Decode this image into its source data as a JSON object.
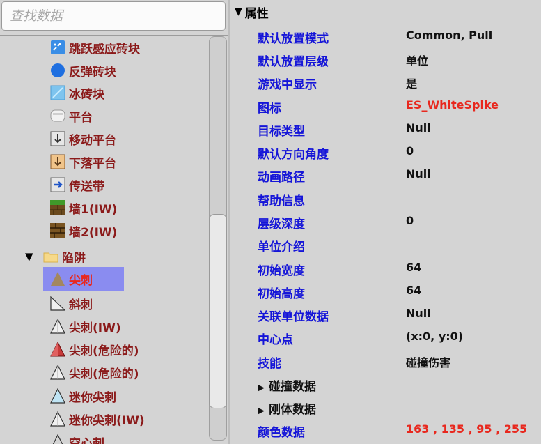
{
  "search": {
    "placeholder": "查找数据"
  },
  "tree": {
    "items": [
      {
        "label": "跳跃感应砖块",
        "icon": "jump-sensor-block-icon"
      },
      {
        "label": "反弹砖块",
        "icon": "bounce-block-icon"
      },
      {
        "label": "冰砖块",
        "icon": "ice-block-icon"
      },
      {
        "label": "平台",
        "icon": "platform-icon"
      },
      {
        "label": "移动平台",
        "icon": "moving-platform-icon"
      },
      {
        "label": "下落平台",
        "icon": "falling-platform-icon"
      },
      {
        "label": "传送带",
        "icon": "conveyor-icon"
      },
      {
        "label": "墙1(IW)",
        "icon": "wall1-icon"
      },
      {
        "label": "墙2(IW)",
        "icon": "wall2-icon"
      },
      {
        "label": "陷阱",
        "icon": "folder-icon"
      },
      {
        "label": "尖刺",
        "icon": "spike-brown-icon"
      },
      {
        "label": "斜刺",
        "icon": "slope-spike-icon"
      },
      {
        "label": "尖刺(IW)",
        "icon": "spike-white-icon"
      },
      {
        "label": "尖刺(危险的)",
        "icon": "spike-red-icon"
      },
      {
        "label": "尖刺(危险的)",
        "icon": "spike-white-icon"
      },
      {
        "label": "迷你尖刺",
        "icon": "mini-spike-blue-icon"
      },
      {
        "label": "迷你尖刺(IW)",
        "icon": "mini-spike-white-icon"
      },
      {
        "label": "空心刺",
        "icon": "hollow-spike-icon"
      }
    ]
  },
  "properties": {
    "header": "属性",
    "rows": [
      {
        "key": "默认放置模式",
        "value": "Common, Pull"
      },
      {
        "key": "默认放置层级",
        "value": "单位"
      },
      {
        "key": "游戏中显示",
        "value": "是"
      },
      {
        "key": "图标",
        "value": "ES_WhiteSpike"
      },
      {
        "key": "目标类型",
        "value": "Null"
      },
      {
        "key": "默认方向角度",
        "value": "0"
      },
      {
        "key": "动画路径",
        "value": "Null"
      },
      {
        "key": "帮助信息",
        "value": ""
      },
      {
        "key": "层级深度",
        "value": "0"
      },
      {
        "key": "单位介绍",
        "value": ""
      },
      {
        "key": "初始宽度",
        "value": "64"
      },
      {
        "key": "初始高度",
        "value": "64"
      },
      {
        "key": "关联单位数据",
        "value": "Null"
      },
      {
        "key": "中心点",
        "value": "(x:0, y:0)"
      },
      {
        "key": "技能",
        "value": "碰撞伤害"
      },
      {
        "key": "碰撞数据",
        "value": ""
      },
      {
        "key": "刚体数据",
        "value": ""
      },
      {
        "key": "颜色数据",
        "value": "163 , 135 , 95 , 255"
      }
    ]
  },
  "colors": {
    "key_blue": "#1515d8",
    "tree_text": "#8b1a1a",
    "highlight_red": "#e8281e",
    "selection_bg": "#8a8cf0",
    "spike_color": "#a3875f"
  }
}
